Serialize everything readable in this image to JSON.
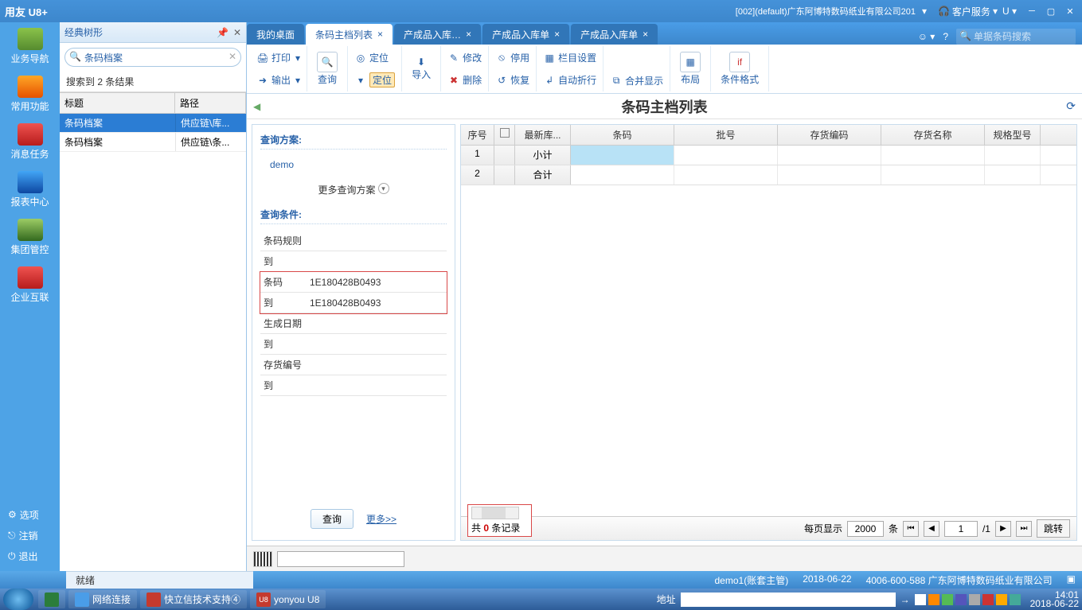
{
  "titlebar": {
    "logo": "用友 U8+",
    "company": "[002](default)广东阿博特数码纸业有限公司201",
    "customer_service": "客户服务",
    "u_label": "U"
  },
  "sidebar_nav": {
    "items": [
      {
        "label": "业务导航"
      },
      {
        "label": "常用功能"
      },
      {
        "label": "消息任务"
      },
      {
        "label": "报表中心"
      },
      {
        "label": "集团管控"
      },
      {
        "label": "企业互联"
      }
    ],
    "bottom": [
      {
        "label": "选项",
        "icon": "gear"
      },
      {
        "label": "注销",
        "icon": "logout"
      },
      {
        "label": "退出",
        "icon": "power"
      }
    ]
  },
  "tree_panel": {
    "title": "经典树形",
    "search_value": "条码档案",
    "result_text": "搜索到 2 条结果",
    "columns": [
      "标题",
      "路径"
    ],
    "rows": [
      {
        "title": "条码档案",
        "path": "供应链\\库...",
        "selected": true
      },
      {
        "title": "条码档案",
        "path": "供应链\\条...",
        "selected": false
      }
    ]
  },
  "tabs": {
    "items": [
      {
        "label": "我的桌面",
        "active": false,
        "close": false
      },
      {
        "label": "条码主档列表",
        "active": true,
        "close": true
      },
      {
        "label": "产成品入库…",
        "active": false,
        "close": true
      },
      {
        "label": "产成品入库单",
        "active": false,
        "close": true
      },
      {
        "label": "产成品入库单",
        "active": false,
        "close": true
      }
    ],
    "search_placeholder": "单据条码搜索"
  },
  "toolbar": {
    "print": "打印",
    "output": "输出",
    "query": "查询",
    "locate": "定位",
    "import": "导入",
    "modify": "修改",
    "delete": "删除",
    "disable": "停用",
    "restore": "恢复",
    "col_setting": "栏目设置",
    "auto_wrap": "自动折行",
    "merge_display": "合并显示",
    "layout": "布局",
    "cond_format": "条件格式"
  },
  "content_title": "条码主档列表",
  "query_panel": {
    "plan_title": "查询方案:",
    "demo": "demo",
    "more_plans": "更多查询方案",
    "cond_title": "查询条件:",
    "fields": [
      {
        "label": "条码规则",
        "value": ""
      },
      {
        "label": "到",
        "value": ""
      },
      {
        "label": "条码",
        "value": "1E180428B0493",
        "hi": true
      },
      {
        "label": "到",
        "value": "1E180428B0493",
        "hi": true
      },
      {
        "label": "生成日期",
        "value": ""
      },
      {
        "label": "到",
        "value": ""
      },
      {
        "label": "存货编号",
        "value": ""
      },
      {
        "label": "到",
        "value": ""
      }
    ],
    "query_btn": "查询",
    "more_link": "更多>>"
  },
  "grid": {
    "columns": [
      "序号",
      "",
      "最新库...",
      "条码",
      "批号",
      "存货编码",
      "存货名称",
      "规格型号"
    ],
    "rows": [
      {
        "seq": "1",
        "c1": "小计"
      },
      {
        "seq": "2",
        "c1": "合计"
      }
    ]
  },
  "pager": {
    "total_prefix": "共",
    "total_count": "0",
    "total_suffix": "条记录",
    "per_page_label": "每页显示",
    "per_page_value": "2000",
    "per_page_unit": "条",
    "current_page": "1",
    "total_pages": "/1",
    "jump": "跳转"
  },
  "status": {
    "ready": "就绪",
    "user": "demo1(账套主管)",
    "date": "2018-06-22",
    "hotline": "4006-600-588 广东阿博特数码纸业有限公司"
  },
  "taskbar": {
    "items": [
      {
        "label": "",
        "iconColor": "#2b7d3b"
      },
      {
        "label": "网络连接",
        "iconColor": "#4a9de8"
      },
      {
        "label": "快立信技术支持④",
        "iconColor": "#c53a2e"
      },
      {
        "label": "yonyou U8",
        "iconColor": "#c53a2e"
      }
    ],
    "addr_label": "地址",
    "clock_time": "14:01",
    "clock_date": "2018-06-22"
  }
}
